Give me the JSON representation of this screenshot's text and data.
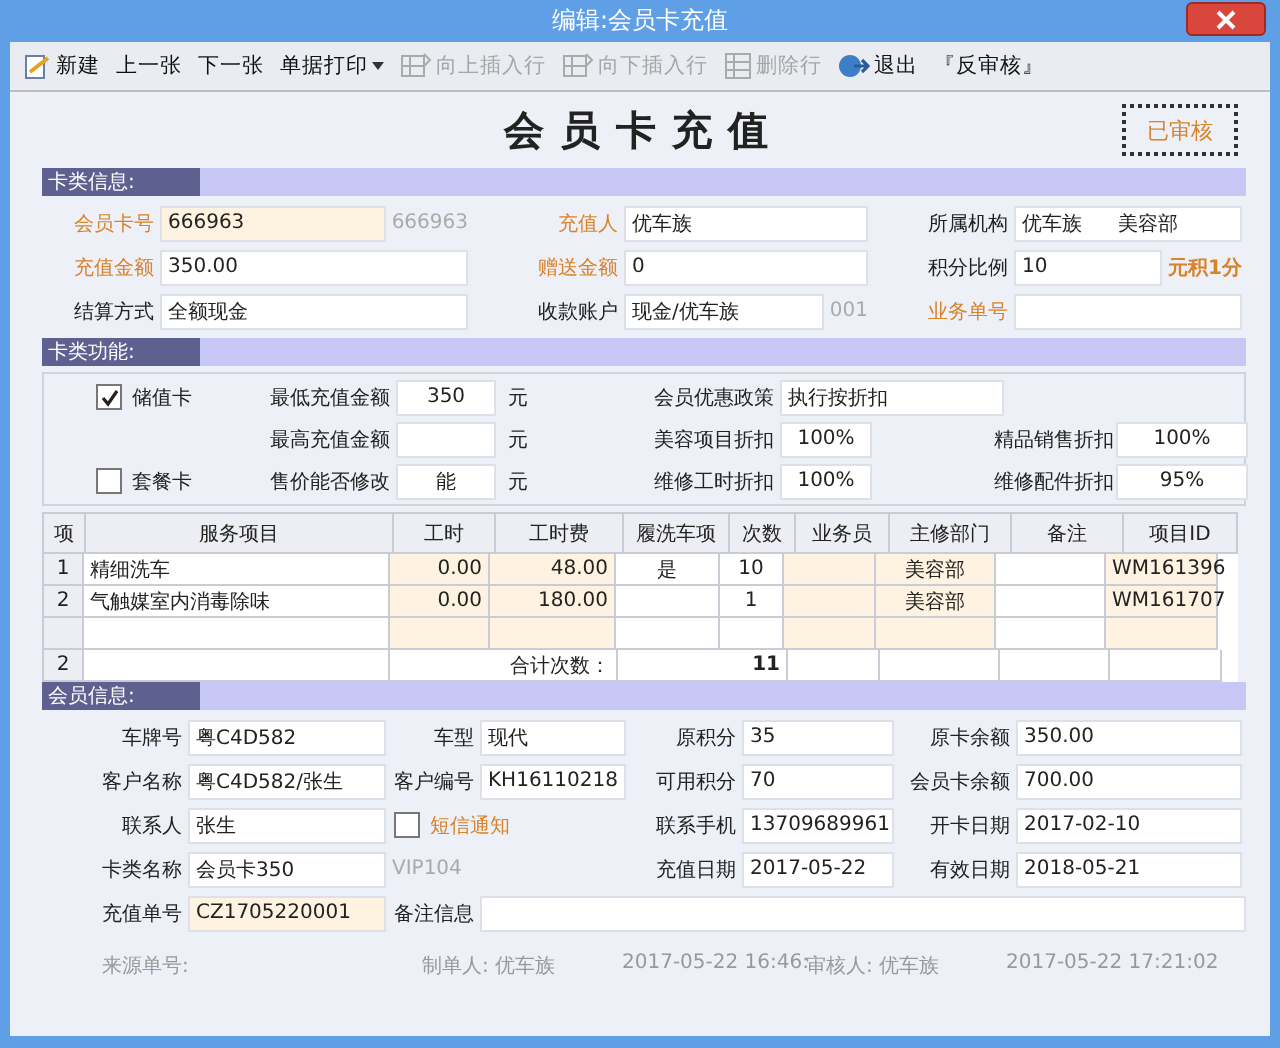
{
  "window": {
    "title": "编辑:会员卡充值"
  },
  "toolbar": [
    {
      "label": "新建",
      "kind": "new",
      "disabled": false
    },
    {
      "label": "上一张",
      "kind": "plain",
      "disabled": false
    },
    {
      "label": "下一张",
      "kind": "plain",
      "disabled": false
    },
    {
      "label": "单据打印",
      "kind": "menu",
      "disabled": false
    },
    {
      "label": "向上插入行",
      "kind": "insert",
      "disabled": true
    },
    {
      "label": "向下插入行",
      "kind": "insert",
      "disabled": true
    },
    {
      "label": "删除行",
      "kind": "delete",
      "disabled": true
    },
    {
      "label": "退出",
      "kind": "exit",
      "disabled": false
    },
    {
      "label": "『反审核』",
      "kind": "plain",
      "disabled": false
    }
  ],
  "form_title": "会员卡充值",
  "status_stamp": "已审核",
  "card_info": {
    "title": "卡类信息:",
    "rows": [
      [
        {
          "kind": "field",
          "label": "会员卡号",
          "emphasis": true,
          "values": [
            "666963"
          ],
          "shaded": true,
          "note": "666963"
        },
        {
          "kind": "field",
          "label": "充值人",
          "emphasis": true,
          "values": [
            "优车族"
          ]
        },
        {
          "kind": "field",
          "label": "所属机构",
          "emphasis": false,
          "values": [
            "优车族",
            "美容部"
          ]
        }
      ],
      [
        {
          "kind": "field",
          "label": "充值金额",
          "emphasis": true,
          "values": [
            "350.00"
          ]
        },
        {
          "kind": "field",
          "label": "赠送金额",
          "emphasis": true,
          "values": [
            "0"
          ]
        },
        {
          "kind": "field",
          "label": "积分比例",
          "emphasis": false,
          "values": [
            "10"
          ],
          "note": "元积1分",
          "note_emphasis": true
        }
      ],
      [
        {
          "kind": "field",
          "label": "结算方式",
          "emphasis": false,
          "values": [
            "全额现金"
          ]
        },
        {
          "kind": "field",
          "label": "收款账户",
          "emphasis": false,
          "values": [
            "现金/优车族"
          ],
          "note": "001"
        },
        {
          "kind": "field",
          "label": "业务单号",
          "emphasis": true
        }
      ]
    ]
  },
  "card_functions": {
    "title": "卡类功能:",
    "rows": [
      {
        "card_type": {
          "label": "储值卡",
          "checked": true
        },
        "fields": [
          {
            "label": "最低充值金额",
            "value": "350",
            "unit": "元"
          },
          {
            "label": "会员优惠政策",
            "value": "执行按折扣",
            "wide": true
          }
        ]
      },
      {
        "fields": [
          {
            "label": "最高充值金额",
            "unit": "元"
          },
          {
            "label": "美容项目折扣",
            "value": "100%"
          },
          {
            "label": "精品销售折扣",
            "value": "100%"
          }
        ]
      },
      {
        "card_type": {
          "label": "套餐卡",
          "checked": false
        },
        "fields": [
          {
            "label": "售价能否修改",
            "value": "能",
            "unit": "元"
          },
          {
            "label": "维修工时折扣",
            "value": "100%"
          },
          {
            "label": "维修配件折扣",
            "value": "95%"
          }
        ]
      }
    ]
  },
  "table": {
    "columns": [
      {
        "label": "项"
      },
      {
        "label": "服务项目",
        "shaded": false
      },
      {
        "label": "工时",
        "shaded": true
      },
      {
        "label": "工时费",
        "shaded": true
      },
      {
        "label": "履洗车项",
        "shaded": false
      },
      {
        "label": "次数",
        "shaded": false
      },
      {
        "label": "业务员",
        "shaded": true
      },
      {
        "label": "主修部门",
        "shaded": true
      },
      {
        "label": "备注",
        "shaded": false
      },
      {
        "label": "项目ID",
        "shaded": true
      }
    ],
    "rows": [
      [
        "1",
        "精细洗车",
        "0.00",
        "48.00",
        "是",
        "10",
        "",
        "美容部",
        "",
        "WM161396"
      ],
      [
        "2",
        "气触媒室内消毒除味",
        "0.00",
        "180.00",
        "",
        "1",
        "",
        "美容部",
        "",
        "WM161707"
      ]
    ],
    "summary": {
      "count": "2",
      "label": "合计次数：",
      "total": "11"
    }
  },
  "member_info": {
    "title": "会员信息:",
    "rows": [
      [
        {
          "kind": "field",
          "label": "车牌号",
          "values": [
            "粤C4D582"
          ]
        },
        {
          "kind": "field",
          "label": "车型",
          "values": [
            "现代"
          ]
        },
        {
          "kind": "field",
          "label": "原积分",
          "values": [
            "35"
          ]
        },
        {
          "kind": "field",
          "label": "原卡余额",
          "values": [
            "350.00"
          ]
        }
      ],
      [
        {
          "kind": "field",
          "label": "客户名称",
          "values": [
            "粤C4D582/张生"
          ]
        },
        {
          "kind": "field",
          "label": "客户编号",
          "values": [
            "KH16110218"
          ]
        },
        {
          "kind": "field",
          "label": "可用积分",
          "values": [
            "70"
          ]
        },
        {
          "kind": "field",
          "label": "会员卡余额",
          "values": [
            "700.00"
          ]
        }
      ],
      [
        {
          "kind": "field",
          "label": "联系人",
          "values": [
            "张生"
          ]
        },
        {
          "kind": "checkbox",
          "label": "短信通知",
          "checked": false,
          "emphasis": true
        },
        {
          "kind": "field",
          "label": "联系手机",
          "values": [
            "13709689961"
          ]
        },
        {
          "kind": "field",
          "label": "开卡日期",
          "values": [
            "2017-02-10"
          ]
        }
      ],
      [
        {
          "kind": "field",
          "label": "卡类名称",
          "values": [
            "会员卡350"
          ]
        },
        {
          "kind": "note",
          "text": "VIP104"
        },
        {
          "kind": "field",
          "label": "充值日期",
          "values": [
            "2017-05-22"
          ]
        },
        {
          "kind": "field",
          "label": "有效日期",
          "values": [
            "2018-05-21"
          ]
        }
      ],
      [
        {
          "kind": "field",
          "label": "充值单号",
          "values": [
            "CZ1705220001"
          ],
          "shaded": true
        },
        {
          "kind": "field",
          "label": "备注信息",
          "wide": true
        }
      ]
    ]
  },
  "footer": [
    "来源单号:",
    "制单人: 优车族",
    "2017-05-22 16:46:",
    "审核人: 优车族",
    "2017-05-22 17:21:02"
  ]
}
